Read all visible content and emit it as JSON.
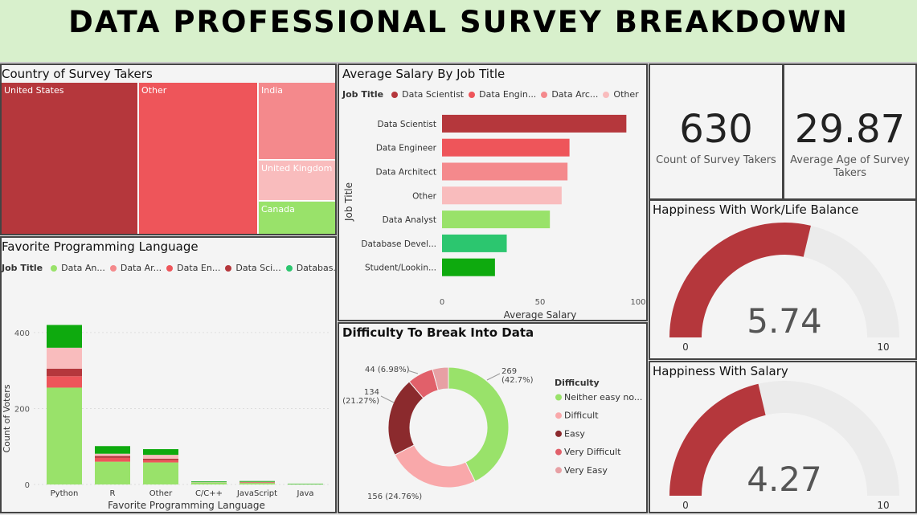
{
  "header": {
    "title": "DATA PROFESSIONAL SURVEY BREAKDOWN"
  },
  "colors": {
    "dark_red": "#b5373c",
    "red": "#ee555a",
    "light_red": "#f4898c",
    "pink": "#f9bcbd",
    "light_green": "#99e26a",
    "green": "#2cc66f",
    "dark_green": "#0eaa0e",
    "header_bg": "#d8f0cc"
  },
  "country": {
    "title": "Country of Survey Takers",
    "tiles": [
      {
        "label": "United States",
        "color": "#b5373c"
      },
      {
        "label": "Other",
        "color": "#ee555a"
      },
      {
        "label": "India",
        "color": "#f4898c"
      },
      {
        "label": "United Kingdom",
        "color": "#f9bcbd"
      },
      {
        "label": "Canada",
        "color": "#99e26a"
      }
    ]
  },
  "salary": {
    "title": "Average Salary By Job Title",
    "legend_title": "Job Title",
    "legend": [
      "Data Scientist",
      "Data Engin...",
      "Data Arc...",
      "Other"
    ],
    "legend_more_icon": "chevron-right-icon",
    "chart_data": {
      "type": "bar",
      "orientation": "horizontal",
      "categories": [
        "Data Scientist",
        "Data Engineer",
        "Data Architect",
        "Other",
        "Data Analyst",
        "Database Devel...",
        "Student/Lookin..."
      ],
      "values": [
        94,
        65,
        64,
        61,
        55,
        33,
        27
      ],
      "colors": [
        "#b5373c",
        "#ee555a",
        "#f4898c",
        "#f9bcbd",
        "#99e26a",
        "#2cc66f",
        "#0eaa0e"
      ],
      "xlabel": "Average Salary",
      "ylabel": "Job Title",
      "xlim": [
        0,
        100
      ],
      "xticks": [
        "0",
        "50",
        "100"
      ]
    }
  },
  "kpi": {
    "count_value": "630",
    "count_label": "Count of Survey Takers",
    "age_value": "29.87",
    "age_label": "Average Age of Survey Takers"
  },
  "worklife": {
    "title": "Happiness With Work/Life Balance",
    "value": "5.74",
    "min": "0",
    "max": "10",
    "chart_data": {
      "type": "gauge",
      "value": 5.74,
      "min": 0,
      "max": 10
    }
  },
  "salary_happy": {
    "title": "Happiness With Salary",
    "value": "4.27",
    "min": "0",
    "max": "10",
    "chart_data": {
      "type": "gauge",
      "value": 4.27,
      "min": 0,
      "max": 10
    }
  },
  "language": {
    "title": "Favorite Programming Language",
    "legend_title": "Job Title",
    "legend": [
      {
        "label": "Data An...",
        "color": "#99e26a"
      },
      {
        "label": "Data Ar...",
        "color": "#f4898c"
      },
      {
        "label": "Data En...",
        "color": "#ee555a"
      },
      {
        "label": "Data Sci...",
        "color": "#b5373c"
      },
      {
        "label": "Databas...",
        "color": "#2cc66f"
      }
    ],
    "legend_more_icon": "chevron-right-icon",
    "chart_data": {
      "type": "bar",
      "stacked": true,
      "categories": [
        "Python",
        "R",
        "Other",
        "C/C++",
        "JavaScript",
        "Java"
      ],
      "series": [
        {
          "name": "Data Analyst",
          "color": "#99e26a",
          "values": [
            255,
            60,
            58,
            5,
            4,
            1
          ]
        },
        {
          "name": "Data Engineer",
          "color": "#ee555a",
          "values": [
            30,
            10,
            6,
            0,
            1,
            0
          ]
        },
        {
          "name": "Data Scientist",
          "color": "#b5373c",
          "values": [
            20,
            5,
            4,
            0,
            1,
            0
          ]
        },
        {
          "name": "Other",
          "color": "#f9bcbd",
          "values": [
            55,
            6,
            10,
            1,
            1,
            0
          ]
        },
        {
          "name": "Student/Looking",
          "color": "#0eaa0e",
          "values": [
            60,
            20,
            15,
            2,
            2,
            1
          ]
        }
      ],
      "xlabel": "Favorite Programming Language",
      "ylabel": "Count of Voters",
      "ylim": [
        0,
        440
      ],
      "yticks": [
        "0",
        "200",
        "400"
      ]
    }
  },
  "difficulty": {
    "title": "Difficulty To Break Into Data",
    "legend_title": "Difficulty",
    "chart_data": {
      "type": "pie",
      "donut": true,
      "slices": [
        {
          "name": "Neither easy no...",
          "value": 269,
          "label": "269\n(42.7%)",
          "color": "#99e26a"
        },
        {
          "name": "Difficult",
          "value": 156,
          "label": "156 (24.76%)",
          "color": "#f9a8aa"
        },
        {
          "name": "Easy",
          "value": 134,
          "label": "134\n(21.27%)",
          "color": "#8b2a2d"
        },
        {
          "name": "Very Difficult",
          "value": 44,
          "label": "44 (6.98%)",
          "color": "#e1606a"
        },
        {
          "name": "Very Easy",
          "value": 27,
          "label": "",
          "color": "#e7a0a4"
        }
      ]
    }
  }
}
